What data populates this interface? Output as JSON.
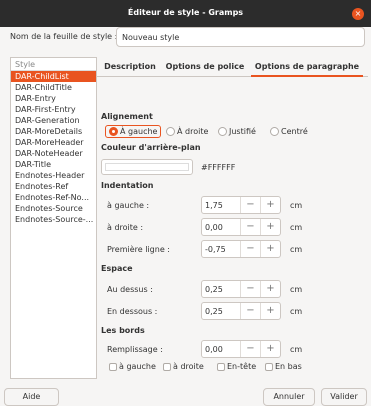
{
  "window": {
    "title": "Éditeur de style - Gramps",
    "close_glyph": "×"
  },
  "stylesheet": {
    "label": "Nom de la feuille de style :",
    "value": "Nouveau style"
  },
  "style_list": {
    "header": "Style",
    "items": [
      "DAR-ChildList",
      "DAR-ChildTitle",
      "DAR-Entry",
      "DAR-First-Entry",
      "DAR-Generation",
      "DAR-MoreDetails",
      "DAR-MoreHeader",
      "DAR-NoteHeader",
      "DAR-Title",
      "Endnotes-Header",
      "Endnotes-Ref",
      "Endnotes-Ref-No...",
      "Endnotes-Source",
      "Endnotes-Source-..."
    ],
    "selected_index": 0
  },
  "tabs": [
    "Description",
    "Options de police",
    "Options de paragraphe"
  ],
  "active_tab": 2,
  "alignment": {
    "title": "Alignement",
    "options": [
      "À gauche",
      "À droite",
      "Justifié",
      "Centré"
    ],
    "selected": 0
  },
  "background": {
    "title": "Couleur d'arrière-plan",
    "value": "#FFFFFF",
    "swatch": "#ffffff"
  },
  "indentation": {
    "title": "Indentation",
    "fields": [
      {
        "label": "à gauche :",
        "value": "1,75",
        "unit": "cm"
      },
      {
        "label": "à droite :",
        "value": "0,00",
        "unit": "cm"
      },
      {
        "label": "Première ligne :",
        "value": "-0,75",
        "unit": "cm"
      }
    ]
  },
  "spacing": {
    "title": "Espace",
    "fields": [
      {
        "label": "Au dessus :",
        "value": "0,25",
        "unit": "cm"
      },
      {
        "label": "En dessous :",
        "value": "0,25",
        "unit": "cm"
      }
    ]
  },
  "borders": {
    "title": "Les bords",
    "padding": {
      "label": "Remplissage :",
      "value": "0,00",
      "unit": "cm"
    },
    "checks": [
      "à gauche",
      "à droite",
      "En-tête",
      "En bas"
    ]
  },
  "spin_glyphs": {
    "minus": "−",
    "plus": "+"
  },
  "buttons": {
    "help": "Aide",
    "cancel": "Annuler",
    "ok": "Valider"
  },
  "colors": {
    "accent": "#e95420",
    "titlebar": "#2c2c2c",
    "window_bg": "#f6f5f4"
  }
}
